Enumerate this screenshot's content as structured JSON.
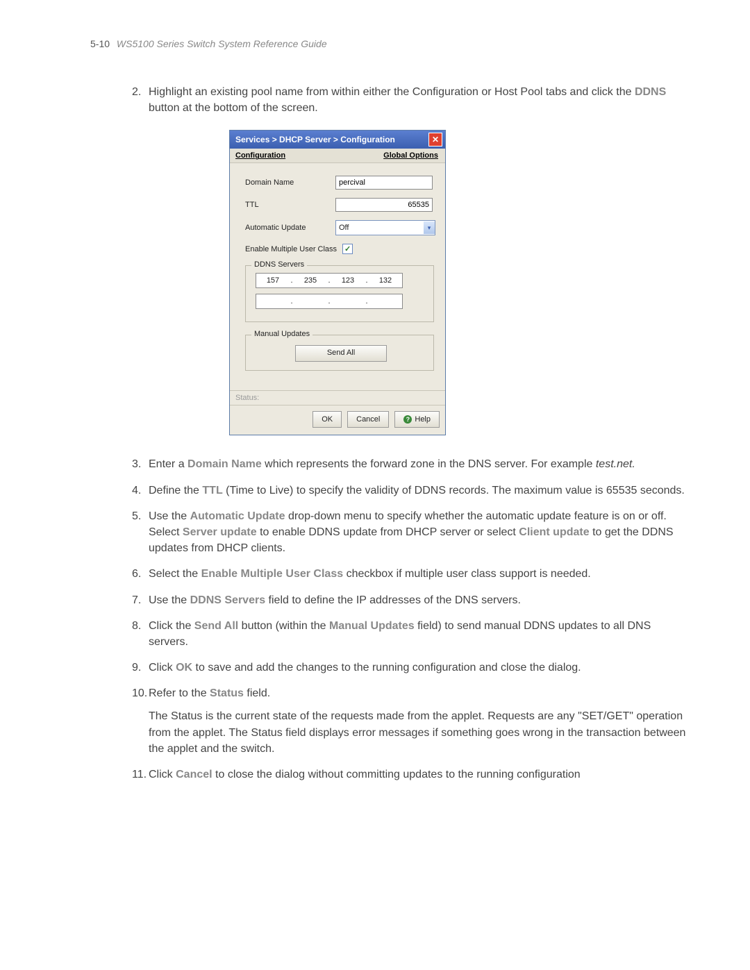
{
  "header": {
    "page_num": "5-10",
    "book_title": "WS5100 Series Switch System Reference Guide"
  },
  "steps": {
    "s2_num": "2.",
    "s2_a": "Highlight an existing pool name from within either the Configuration or Host Pool tabs and click the ",
    "s2_bold": "DDNS",
    "s2_b": " button at the bottom of the screen.",
    "s3_num": "3.",
    "s3_a": "Enter a ",
    "s3_bold": "Domain Name",
    "s3_b": " which represents the forward zone in the DNS server. For example ",
    "s3_ital": "test.net.",
    "s4_num": "4.",
    "s4_a": "Define the ",
    "s4_bold": "TTL",
    "s4_b": " (Time to Live) to specify the validity of DDNS records. The maximum value is 65535 seconds.",
    "s5_num": "5.",
    "s5_a": "Use the ",
    "s5_bold1": "Automatic Update",
    "s5_b": " drop-down menu to specify whether the automatic update feature is on or off. Select ",
    "s5_bold2": "Server update",
    "s5_c": " to enable DDNS update from DHCP server or select ",
    "s5_bold3": "Client update",
    "s5_d": " to get the DDNS updates from DHCP clients.",
    "s6_num": "6.",
    "s6_a": "Select the ",
    "s6_bold": "Enable Multiple User Class",
    "s6_b": " checkbox if multiple user class support is needed.",
    "s7_num": "7.",
    "s7_a": "Use the ",
    "s7_bold": "DDNS Servers",
    "s7_b": " field to define the IP addresses of the DNS servers.",
    "s8_num": "8.",
    "s8_a": "Click the ",
    "s8_bold1": "Send All",
    "s8_b": " button (within the ",
    "s8_bold2": "Manual Updates",
    "s8_c": " field) to send manual DDNS updates to all DNS servers.",
    "s9_num": "9.",
    "s9_a": "Click ",
    "s9_bold": "OK",
    "s9_b": " to save and add the changes to the running configuration and close the dialog.",
    "s10_num": "10.",
    "s10_a": "Refer to the ",
    "s10_bold": "Status",
    "s10_b": " field.",
    "s10_sub": "The Status is the current state of the requests made from the applet. Requests are any \"SET/GET\" operation from the applet. The Status field displays error messages if something goes wrong in the transaction between the applet and the switch.",
    "s11_num": "11.",
    "s11_a": "Click ",
    "s11_bold": "Cancel",
    "s11_b": " to close the dialog without committing updates to the running configuration"
  },
  "dialog": {
    "title": "Services > DHCP Server > Configuration",
    "tab_left": "Configuration",
    "tab_right": "Global Options",
    "domain_name_label": "Domain Name",
    "domain_name_value": "percival",
    "ttl_label": "TTL",
    "ttl_value": "65535",
    "auto_update_label": "Automatic Update",
    "auto_update_value": "Off",
    "enable_multi_label": "Enable Multiple User Class",
    "ddns_servers_label": "DDNS Servers",
    "ip1": {
      "o1": "157",
      "o2": "235",
      "o3": "123",
      "o4": "132"
    },
    "ip2": {
      "o1": "",
      "o2": "",
      "o3": "",
      "o4": ""
    },
    "manual_updates_label": "Manual Updates",
    "send_all_btn": "Send All",
    "status_label": "Status:",
    "ok_btn": "OK",
    "cancel_btn": "Cancel",
    "help_btn": "Help"
  }
}
